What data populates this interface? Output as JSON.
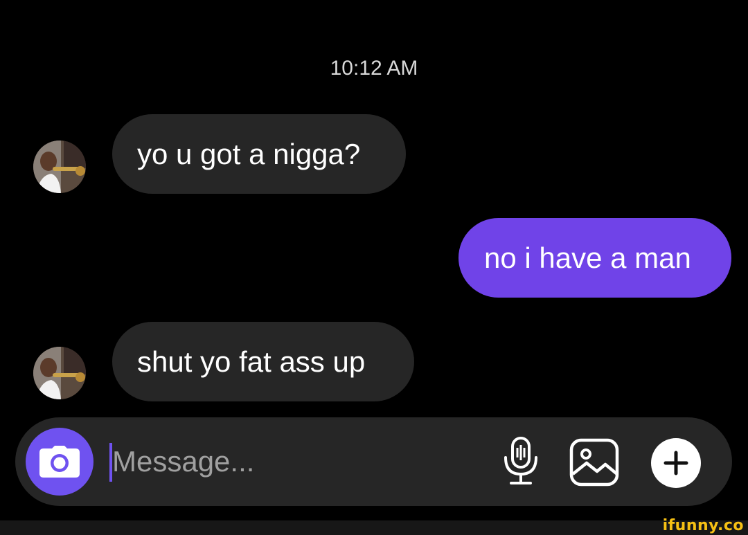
{
  "chat": {
    "timestamp": "10:12 AM",
    "messages": [
      {
        "direction": "incoming",
        "text": "yo u got a nigga?"
      },
      {
        "direction": "outgoing",
        "text": "no i have a man"
      },
      {
        "direction": "incoming",
        "text": "shut yo fat ass up"
      }
    ]
  },
  "composer": {
    "placeholder": "Message...",
    "value": "",
    "icons": {
      "camera": "camera-icon",
      "mic": "microphone-icon",
      "gallery": "image-gallery-icon",
      "add": "plus-icon"
    }
  },
  "theme": {
    "background": "#000000",
    "incoming_bubble": "#262626",
    "outgoing_bubble": "#7043e8",
    "accent": "#6f52f0"
  },
  "watermark": {
    "text": "ifunny.co"
  }
}
